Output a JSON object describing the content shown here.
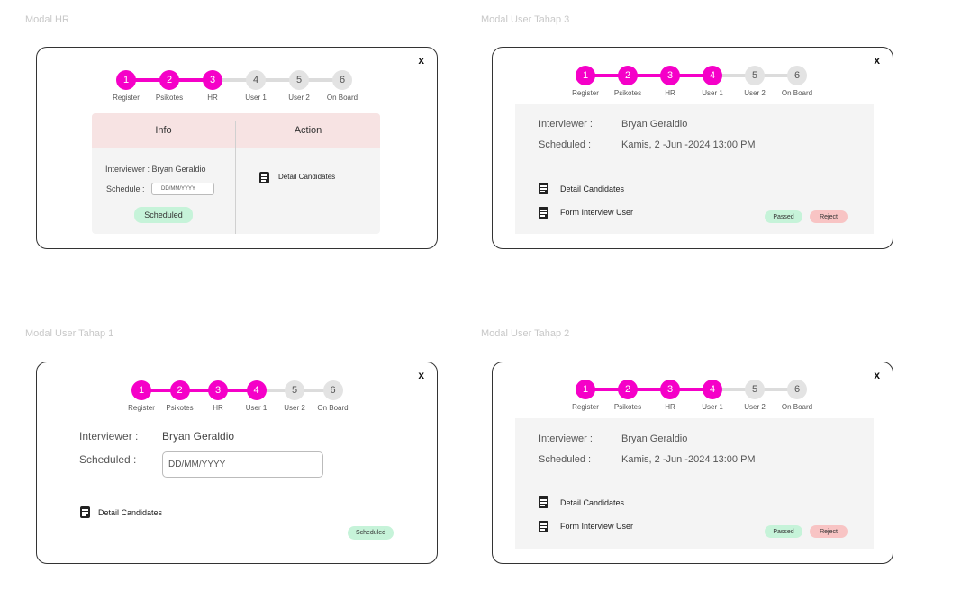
{
  "frames": {
    "hr": "Modal HR",
    "user3": "Modal User Tahap 3",
    "user1": "Modal User Tahap 1",
    "user2": "Modal User Tahap 2"
  },
  "close_label": "x",
  "steps": {
    "numbers": [
      "1",
      "2",
      "3",
      "4",
      "5",
      "6"
    ],
    "labels": [
      "Register",
      "Psikotes",
      "HR",
      "User 1",
      "User 2",
      "On Board"
    ]
  },
  "modal_hr": {
    "info_header": "Info",
    "action_header": "Action",
    "interviewer_text": "Interviewer : Bryan Geraldio",
    "schedule_label": "Schedule :",
    "date_placeholder": "DD/MM/YYYY",
    "status_badge": "Scheduled",
    "detail_link": "Detail Candidates",
    "active_steps": 3
  },
  "modal_user3": {
    "interviewer_label": "Interviewer :",
    "interviewer_value": "Bryan Geraldio",
    "scheduled_label": "Scheduled :",
    "scheduled_value": "Kamis, 2 -Jun -2024 13:00 PM",
    "detail_link": "Detail Candidates",
    "form_link": "Form Interview User",
    "passed_button": "Passed",
    "reject_button": "Reject",
    "active_steps": 4
  },
  "modal_user1": {
    "interviewer_label": "Interviewer :",
    "interviewer_value": "Bryan Geraldio",
    "scheduled_label": "Scheduled :",
    "date_placeholder": "DD/MM/YYYY",
    "detail_link": "Detail Candidates",
    "status_badge": "Scheduled",
    "active_steps": 4
  },
  "modal_user2": {
    "interviewer_label": "Interviewer :",
    "interviewer_value": "Bryan Geraldio",
    "scheduled_label": "Scheduled :",
    "scheduled_value": "Kamis, 2 -Jun -2024 13:00 PM",
    "detail_link": "Detail Candidates",
    "form_link": "Form Interview User",
    "passed_button": "Passed",
    "reject_button": "Reject",
    "active_steps": 4
  },
  "colors": {
    "accent": "#f500c8",
    "inactive_step": "#e3e3e3",
    "panel": "#f4f4f4",
    "header_pink": "#f7e3e3",
    "passed_green": "#c6f3d9",
    "reject_red": "#f8c4c4"
  },
  "icons": [
    "close-icon",
    "document-icon"
  ]
}
